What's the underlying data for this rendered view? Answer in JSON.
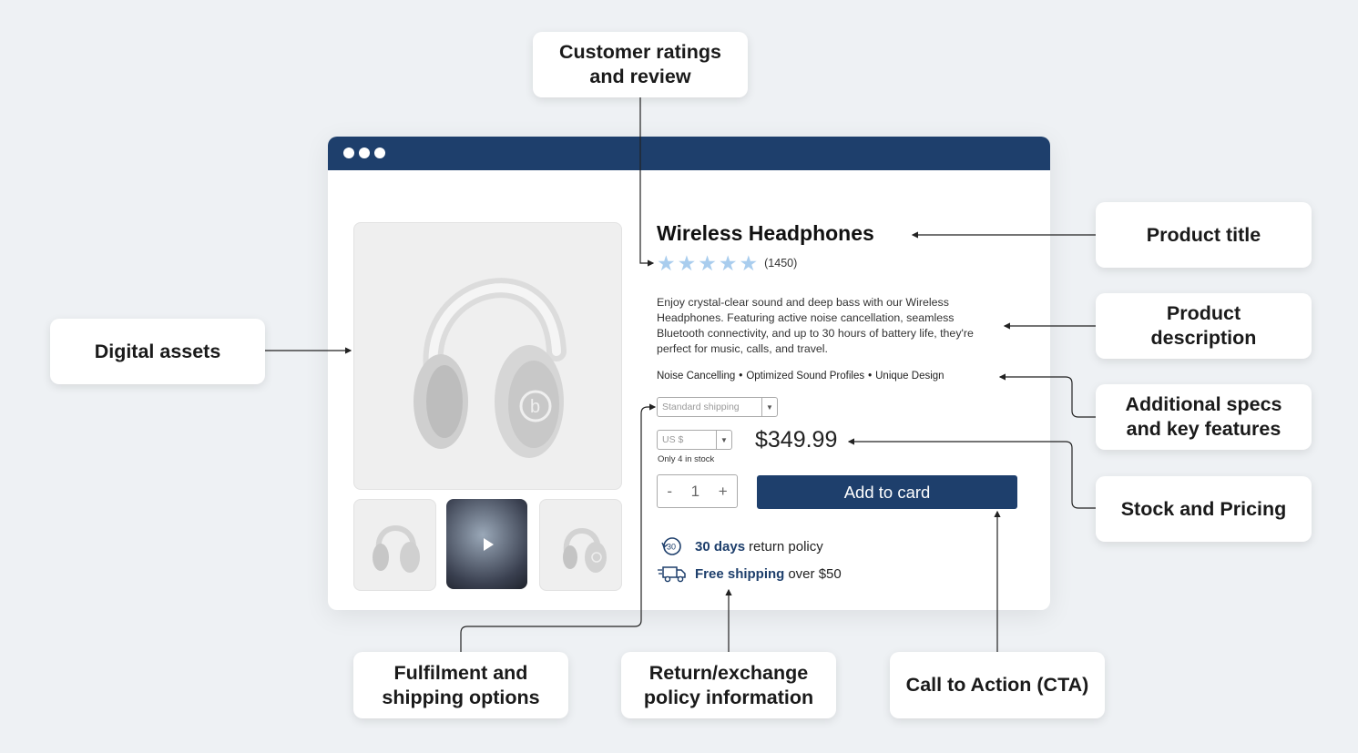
{
  "product": {
    "title": "Wireless Headphones",
    "rating_stars": 5,
    "rating_count": "(1450)",
    "description": "Enjoy crystal-clear sound and deep bass with our Wireless Headphones. Featuring active noise cancellation, seamless Bluetooth connectivity, and up to 30 hours of battery life, they're perfect for music, calls, and travel.",
    "features": [
      "Noise Cancelling",
      "Optimized Sound Profiles",
      "Unique Design"
    ],
    "shipping_select": "Standard shipping",
    "currency_select": "US $",
    "stock": "Only 4 in stock",
    "price": "$349.99",
    "quantity": "1",
    "qty_minus": "-",
    "qty_plus": "+",
    "cta": "Add to card",
    "return_bold": "30 days",
    "return_rest": "return policy",
    "return_icon_text": "30",
    "shipping_bold": "Free shipping",
    "shipping_rest": "over $50"
  },
  "callouts": {
    "ratings": [
      "Customer ratings",
      "and review"
    ],
    "digital_assets": "Digital assets",
    "product_title": "Product title",
    "product_description": [
      "Product",
      "description"
    ],
    "specs": [
      "Additional specs",
      "and key features"
    ],
    "stock_pricing": "Stock and Pricing",
    "fulfilment": [
      "Fulfilment and",
      "shipping options"
    ],
    "return_policy": [
      "Return/exchange",
      "policy information"
    ],
    "cta": "Call to Action (CTA)"
  },
  "colors": {
    "brand": "#1e3f6c",
    "star": "#a9cdee",
    "background": "#eef1f4"
  }
}
